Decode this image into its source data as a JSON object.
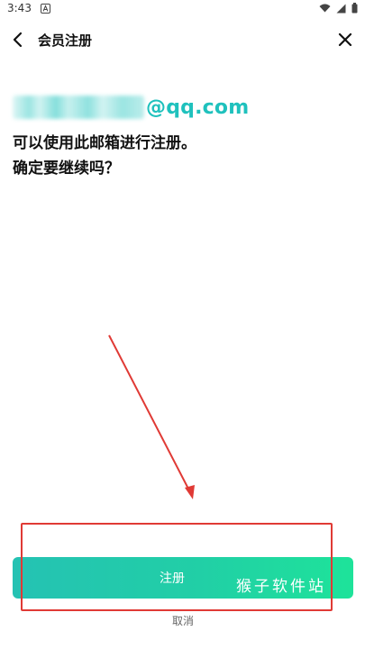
{
  "status_bar": {
    "time": "3:43",
    "icons": [
      "notification-a-icon",
      "wifi-icon",
      "cellular-signal-icon",
      "battery-icon"
    ]
  },
  "nav": {
    "title": "会员注册",
    "back_icon": "chevron-left-icon",
    "close_icon": "close-icon"
  },
  "email": {
    "domain": "@qq.com"
  },
  "message": {
    "line1": "可以使用此邮箱进行注册。",
    "line2": "确定要继续吗？"
  },
  "actions": {
    "register_label": "注册",
    "cancel_label": "取消"
  },
  "watermark": {
    "text": "猴子软件站"
  },
  "colors": {
    "accent": "#1fc1bd",
    "button_gradient_start": "#25c2b3",
    "button_gradient_end": "#1ee39a",
    "annotation_red": "#e03a35"
  }
}
